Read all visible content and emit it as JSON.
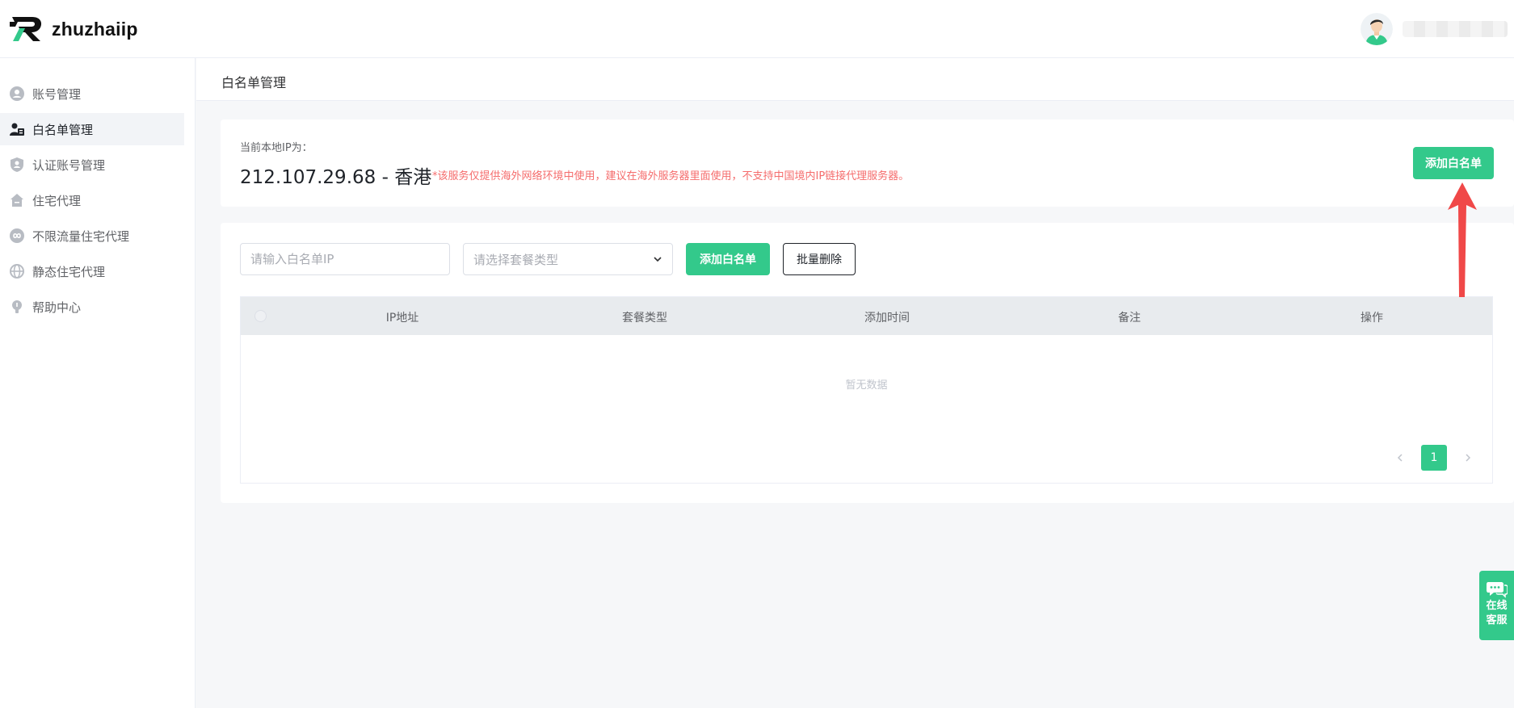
{
  "brand": {
    "name": "zhuzhaiip"
  },
  "sidebar": {
    "items": [
      {
        "label": "账号管理",
        "icon": "user-circle-icon",
        "active": false
      },
      {
        "label": "白名单管理",
        "icon": "user-list-icon",
        "active": true
      },
      {
        "label": "认证账号管理",
        "icon": "shield-user-icon",
        "active": false
      },
      {
        "label": "住宅代理",
        "icon": "house-icon",
        "active": false
      },
      {
        "label": "不限流量住宅代理",
        "icon": "infinity-icon",
        "active": false
      },
      {
        "label": "静态住宅代理",
        "icon": "globe-icon",
        "active": false
      },
      {
        "label": "帮助中心",
        "icon": "lightbulb-icon",
        "active": false
      }
    ]
  },
  "page": {
    "title": "白名单管理"
  },
  "ip_card": {
    "label": "当前本地IP为：",
    "value": "212.107.29.68 - 香港",
    "warning": "*该服务仅提供海外网络环境中使用，建议在海外服务器里面使用，不支持中国境内IP链接代理服务器。",
    "add_button": "添加白名单"
  },
  "filters": {
    "ip_placeholder": "请输入白名单IP",
    "package_placeholder": "请选择套餐类型",
    "add_button": "添加白名单",
    "batch_delete_button": "批量删除"
  },
  "table": {
    "columns": [
      "IP地址",
      "套餐类型",
      "添加时间",
      "备注",
      "操作"
    ],
    "empty_text": "暂无数据"
  },
  "pagination": {
    "current": "1"
  },
  "chat": {
    "line1": "在线",
    "line2": "客服"
  },
  "colors": {
    "primary": "#33c98b",
    "warning": "#f56c6c",
    "annotation_arrow": "#f04848"
  }
}
